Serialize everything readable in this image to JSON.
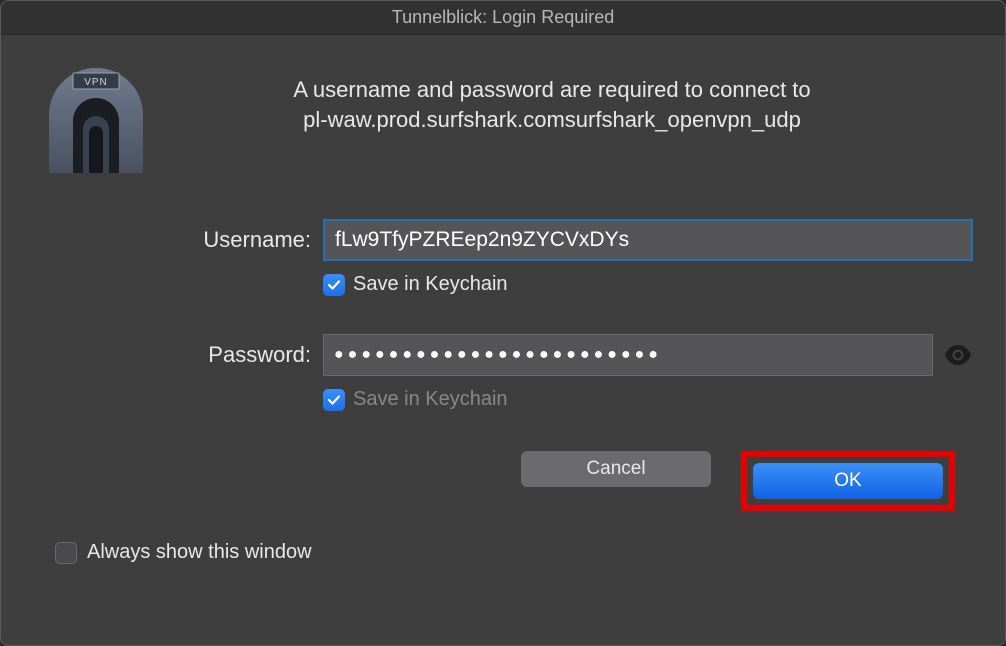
{
  "title": "Tunnelblick: Login Required",
  "message_line1": "A username and password are required to connect to",
  "message_line2": "pl-waw.prod.surfshark.comsurfshark_openvpn_udp",
  "form": {
    "username_label": "Username:",
    "username_value": "fLw9TfyPZREep2n9ZYCVxDYs",
    "username_save_label": "Save in Keychain",
    "username_save_checked": true,
    "password_label": "Password:",
    "password_masked": "●●●●●●●●●●●●●●●●●●●●●●●●",
    "password_save_label": "Save in Keychain",
    "password_save_checked": true
  },
  "buttons": {
    "cancel": "Cancel",
    "ok": "OK"
  },
  "always_show": {
    "label": "Always show this window",
    "checked": false
  },
  "icons": {
    "app": "tunnelblick-vpn-icon",
    "eye": "eye-icon",
    "check": "checkmark-icon"
  },
  "colors": {
    "accent": "#1e6fe8",
    "highlight": "#e60000"
  }
}
